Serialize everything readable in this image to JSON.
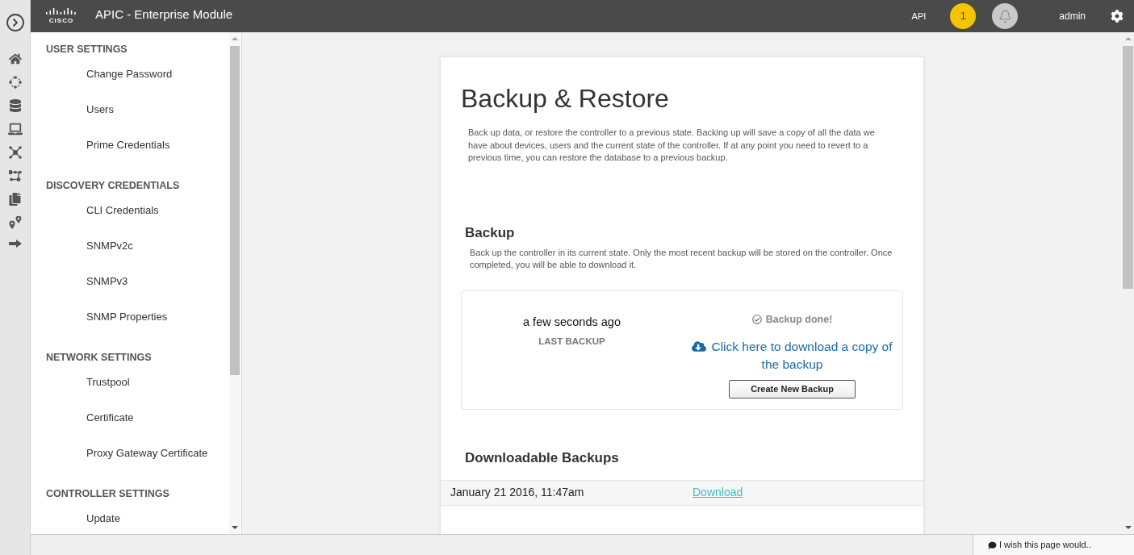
{
  "header": {
    "logo_text": "CISCO",
    "title": "APIC - Enterprise Module",
    "api_label": "API",
    "notification_count": "1",
    "user": "admin"
  },
  "sidebar": {
    "sections": [
      {
        "heading": "USER SETTINGS",
        "items": [
          "Change Password",
          "Users",
          "Prime Credentials"
        ]
      },
      {
        "heading": "DISCOVERY CREDENTIALS",
        "items": [
          "CLI Credentials",
          "SNMPv2c",
          "SNMPv3",
          "SNMP Properties"
        ]
      },
      {
        "heading": "NETWORK SETTINGS",
        "items": [
          "Trustpool",
          "Certificate",
          "Proxy Gateway Certificate"
        ]
      },
      {
        "heading": "CONTROLLER SETTINGS",
        "items": [
          "Update"
        ]
      }
    ]
  },
  "page": {
    "title": "Backup & Restore",
    "intro": "Back up data, or restore the controller to a previous state. Backing up will save a copy of all the data we have about devices, users and the current state of the controller. If at any point you need to revert to a previous time, you can restore the database to a previous backup.",
    "backup": {
      "heading": "Backup",
      "description": "Back up the controller in its current state. Only the most recent backup will be stored on the controller. Once completed, you will be able to download it.",
      "last_backup_time": "a few seconds ago",
      "last_backup_label": "LAST BACKUP",
      "status": "Backup done!",
      "download_link": "Click here to download a copy of the backup",
      "create_button": "Create New Backup"
    },
    "downloadable": {
      "heading": "Downloadable Backups",
      "rows": [
        {
          "date": "January 21 2016, 11:47am",
          "action": "Download"
        }
      ]
    }
  },
  "feedback": {
    "label": "I wish this page would.."
  }
}
